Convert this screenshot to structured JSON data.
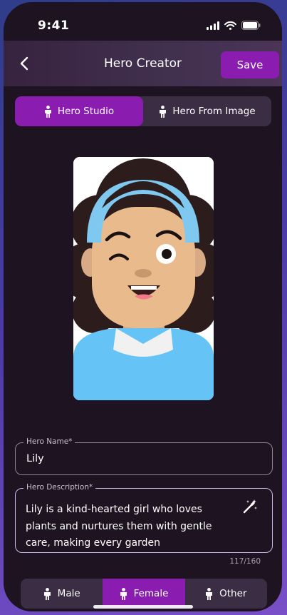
{
  "status": {
    "time": "9:41"
  },
  "header": {
    "title": "Hero Creator",
    "save_label": "Save"
  },
  "modes": [
    {
      "label": "Hero Studio",
      "active": true
    },
    {
      "label": "Hero From Image",
      "active": false
    }
  ],
  "form": {
    "name_label": "Hero Name*",
    "name_value": "Lily",
    "desc_label": "Hero Description*",
    "desc_value": "Lily is a kind-hearted girl who loves plants and nurtures them with gentle care, making every garden",
    "counter": "117/160"
  },
  "gender": [
    {
      "label": "Male",
      "active": false
    },
    {
      "label": "Female",
      "active": true
    },
    {
      "label": "Other",
      "active": false
    }
  ],
  "colors": {
    "accent": "#8a1db0",
    "background": "#1e1320",
    "segment": "#3a2d44"
  }
}
